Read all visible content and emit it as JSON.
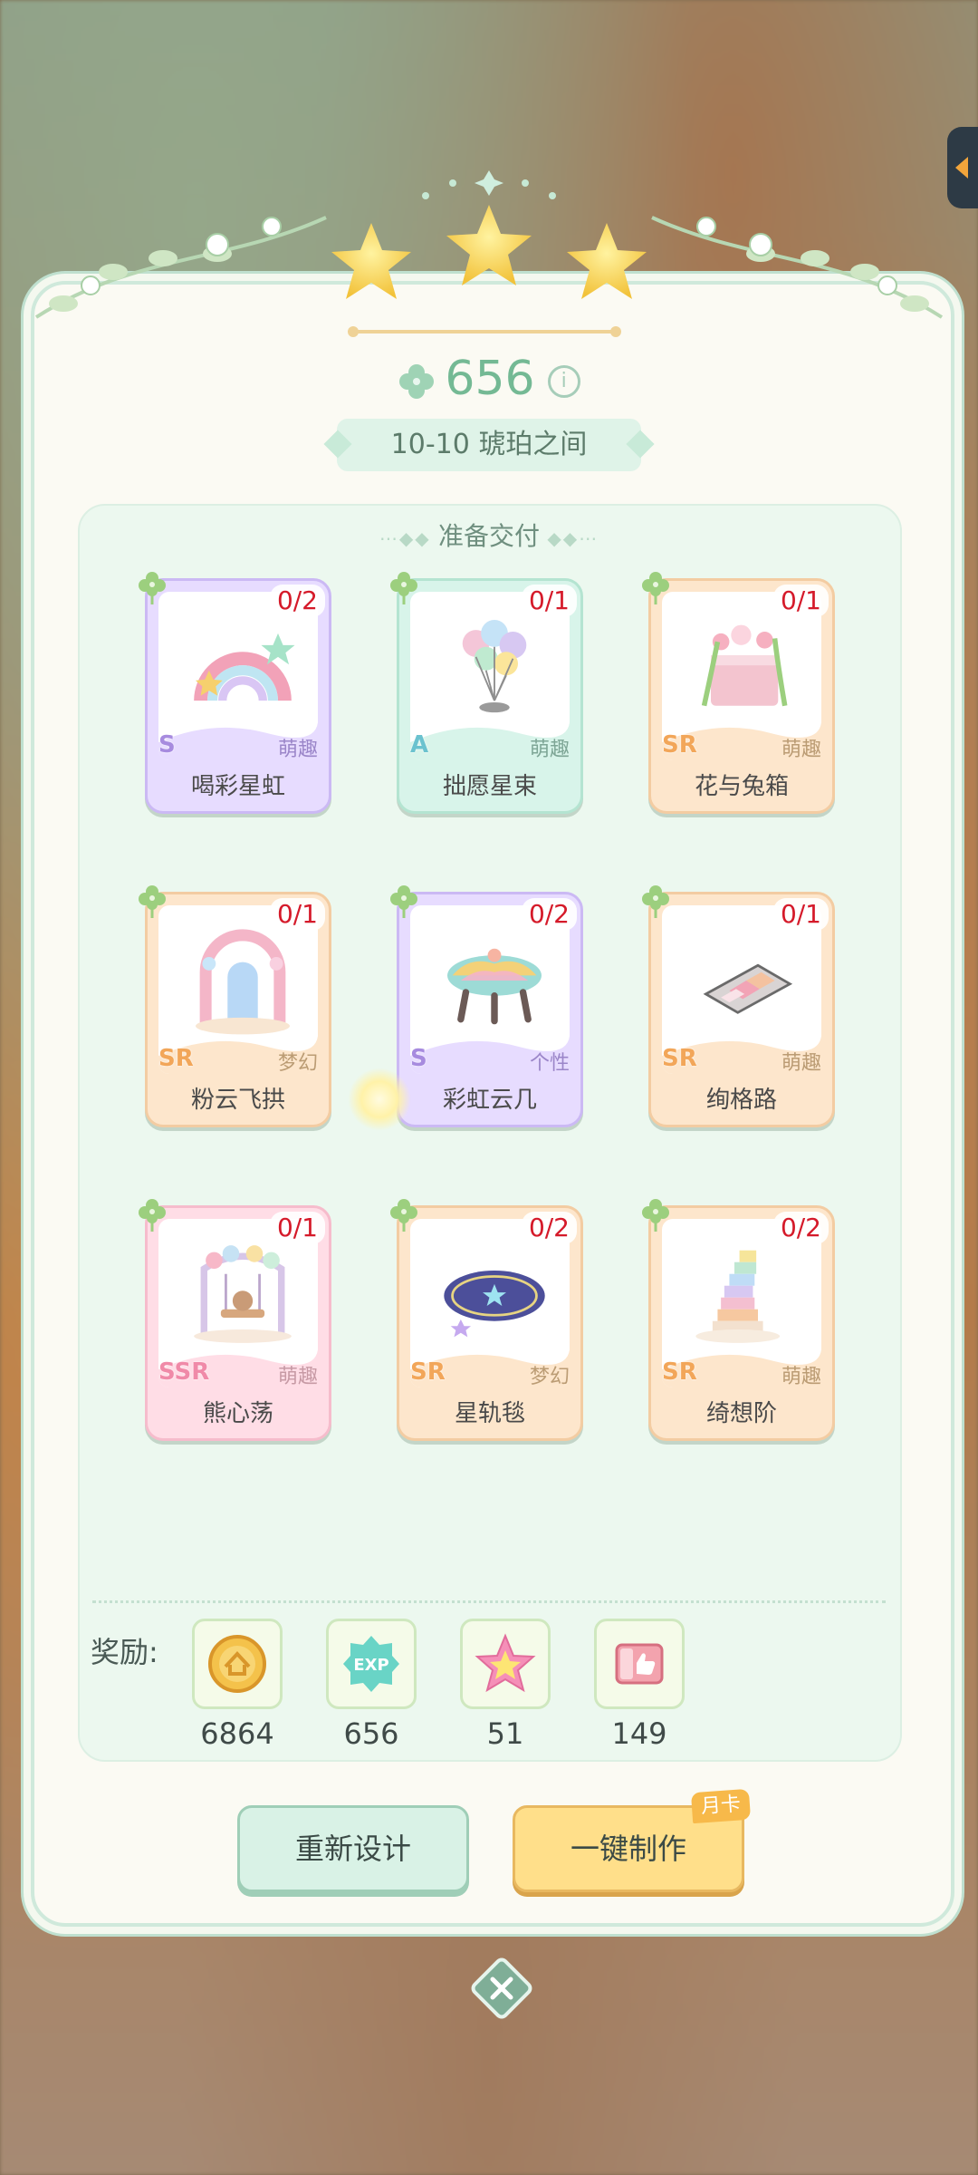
{
  "score": {
    "value": "656",
    "info_icon": "info-icon"
  },
  "stage": {
    "label": "10-10  琥珀之间"
  },
  "delivery": {
    "title": "准备交付"
  },
  "items": [
    {
      "name": "喝彩星虹",
      "count": "0/2",
      "rarity": "S",
      "style": "萌趣",
      "icon": "rainbow-arch-icon"
    },
    {
      "name": "拙愿星束",
      "count": "0/1",
      "rarity": "A",
      "style": "萌趣",
      "icon": "balloon-bunch-icon"
    },
    {
      "name": "花与兔箱",
      "count": "0/1",
      "rarity": "SR",
      "style": "萌趣",
      "icon": "flower-box-icon"
    },
    {
      "name": "粉云飞拱",
      "count": "0/1",
      "rarity": "SR",
      "style": "梦幻",
      "icon": "cloud-arch-icon"
    },
    {
      "name": "彩虹云几",
      "count": "0/2",
      "rarity": "S",
      "style": "个性",
      "icon": "cloud-table-icon"
    },
    {
      "name": "绚格路",
      "count": "0/1",
      "rarity": "SR",
      "style": "萌趣",
      "icon": "grid-path-icon"
    },
    {
      "name": "熊心荡",
      "count": "0/1",
      "rarity": "SSR",
      "style": "萌趣",
      "icon": "bear-swing-icon"
    },
    {
      "name": "星轨毯",
      "count": "0/2",
      "rarity": "SR",
      "style": "梦幻",
      "icon": "star-rug-icon"
    },
    {
      "name": "绮想阶",
      "count": "0/2",
      "rarity": "SR",
      "style": "萌趣",
      "icon": "rainbow-stairs-icon"
    }
  ],
  "rewards": {
    "label": "奖励:",
    "items": [
      {
        "icon": "coin-icon",
        "value": "6864"
      },
      {
        "icon": "exp-icon",
        "value": "656"
      },
      {
        "icon": "star-icon",
        "value": "51"
      },
      {
        "icon": "thumbs-up-card-icon",
        "value": "149"
      }
    ]
  },
  "buttons": {
    "redesign": "重新设计",
    "one_click_make": "一键制作",
    "monthly_card_tag": "月卡"
  },
  "colors": {
    "accent_green": "#74b994",
    "count_red": "#d51a2a",
    "gold": "#ffdf8a"
  }
}
